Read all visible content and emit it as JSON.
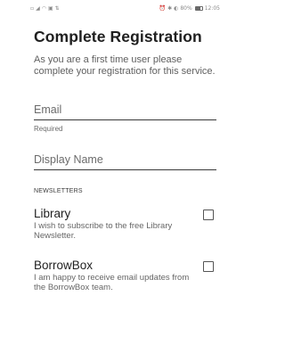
{
  "status_bar": {
    "left_icons": [
      "sim-icon",
      "signal-icon",
      "wifi-icon",
      "nfc-icon",
      "data-icon"
    ],
    "right_icons": [
      "alarm-icon",
      "bluetooth-icon",
      "rotation-icon"
    ],
    "battery_text": "80%",
    "time": "12:05"
  },
  "header": {
    "title": "Complete Registration",
    "intro": "As you are a first time user please complete your registration for this service."
  },
  "form": {
    "email": {
      "placeholder": "Email",
      "value": "",
      "helper": "Required"
    },
    "display_name": {
      "placeholder": "Display Name",
      "value": ""
    }
  },
  "newsletters": {
    "section_label": "NEWSLETTERS",
    "items": [
      {
        "title": "Library",
        "description": "I wish to subscribe to the free Library Newsletter.",
        "checked": false
      },
      {
        "title": "BorrowBox",
        "description": "I am happy to receive email updates from the BorrowBox team.",
        "checked": false
      }
    ]
  },
  "colors": {
    "title": "#1f1f1f",
    "secondary_text": "#5f5f5f",
    "underline": "#3a3a3a",
    "background": "#ffffff"
  }
}
